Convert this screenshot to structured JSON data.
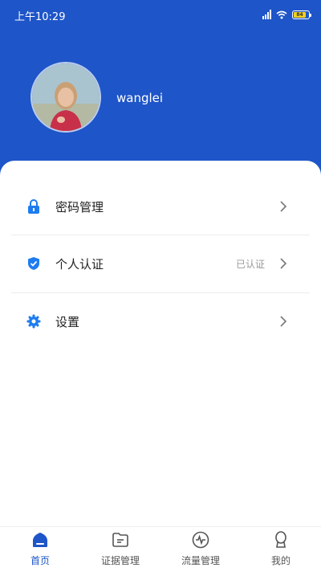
{
  "status_bar": {
    "time": "上午10:29",
    "battery": "84"
  },
  "profile": {
    "username": "wanglei"
  },
  "menu": {
    "items": [
      {
        "label": "密码管理",
        "icon": "lock-icon",
        "status": ""
      },
      {
        "label": "个人认证",
        "icon": "shield-check-icon",
        "status": "已认证"
      },
      {
        "label": "设置",
        "icon": "gear-icon",
        "status": ""
      }
    ]
  },
  "tabbar": {
    "tabs": [
      {
        "label": "首页",
        "icon": "home-icon",
        "active": true
      },
      {
        "label": "证据管理",
        "icon": "folder-icon",
        "active": false
      },
      {
        "label": "流量管理",
        "icon": "pulse-icon",
        "active": false
      },
      {
        "label": "我的",
        "icon": "user-icon",
        "active": false
      }
    ]
  },
  "colors": {
    "primary": "#1e55c8",
    "icon_blue": "#1e7cf0",
    "muted": "#999999"
  }
}
